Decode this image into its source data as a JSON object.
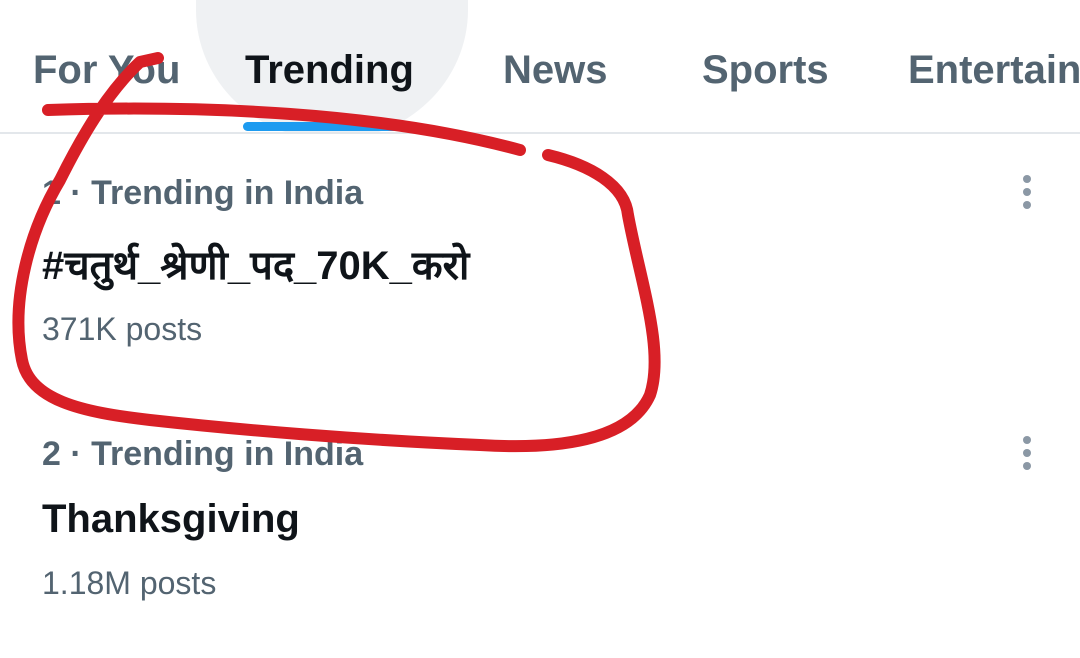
{
  "tabs": [
    {
      "label": "For You"
    },
    {
      "label": "Trending"
    },
    {
      "label": "News"
    },
    {
      "label": "Sports"
    },
    {
      "label": "Entertain"
    }
  ],
  "active_tab": "Trending",
  "trends": [
    {
      "meta": "1 · Trending in India",
      "title": "#चतुर्थ_श्रेणी_पद_70K_करो",
      "count": "371K posts"
    },
    {
      "meta": "2 · Trending in India",
      "title": "Thanksgiving",
      "count": "1.18M posts"
    }
  ],
  "colors": {
    "accent": "#1d9bf0",
    "annotation": "#d81f26",
    "secondary_text": "#536471",
    "primary_text": "#0f1419"
  },
  "icons": {
    "more": "more-vertical-icon"
  }
}
